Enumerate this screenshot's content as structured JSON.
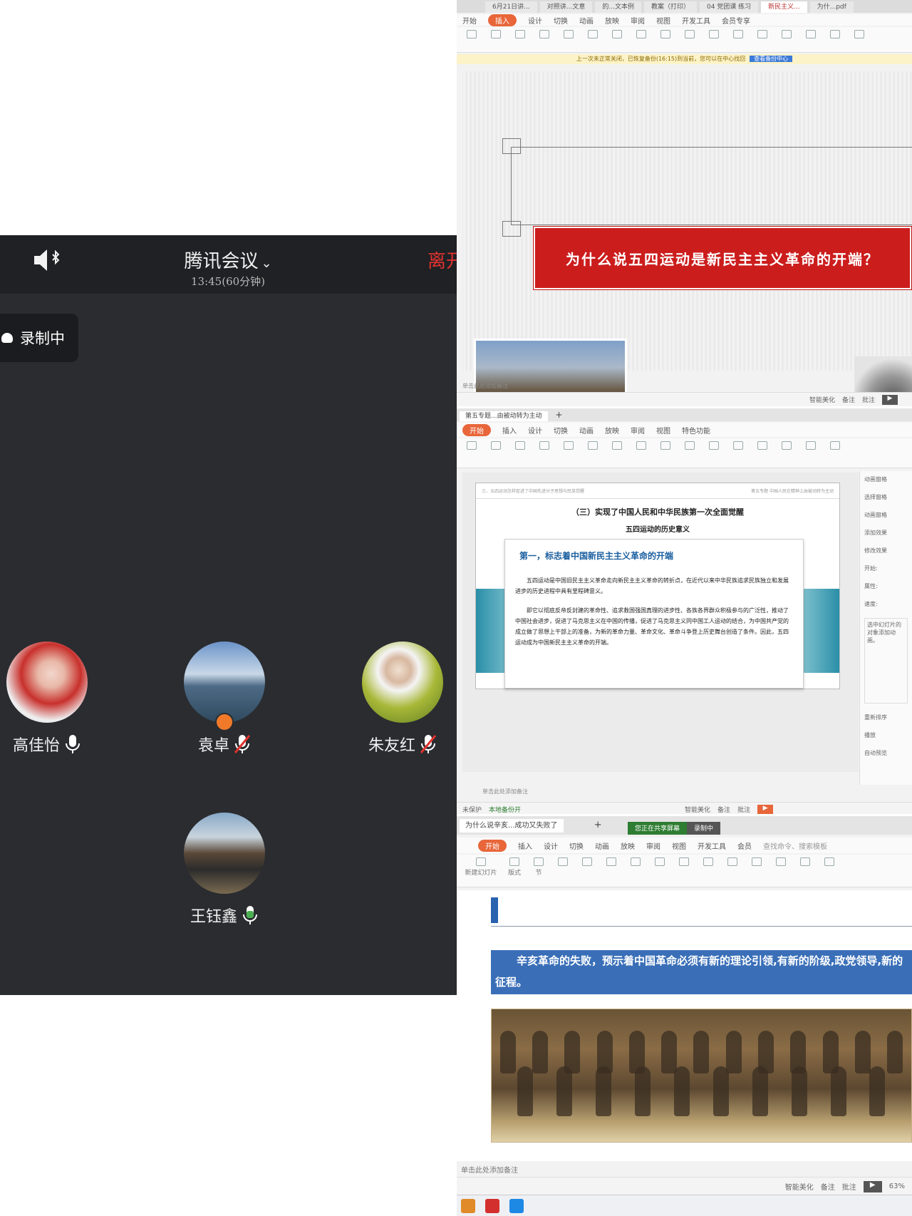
{
  "meeting": {
    "title": "腾讯会议",
    "time": "13:45(60分钟)",
    "end_label": "离开",
    "recording_label": "录制中",
    "participants": [
      {
        "name": "高佳怡",
        "mic": "on"
      },
      {
        "name": "袁卓",
        "mic": "muted",
        "host": true
      },
      {
        "name": "朱友红",
        "mic": "muted"
      },
      {
        "name": "王钰鑫",
        "mic": "active"
      }
    ],
    "colors": {
      "bg": "#2a2c30",
      "topbar": "#1f2124",
      "end": "#e0322f",
      "mic_active": "#4caf50",
      "mic_muted": "#e0322f"
    }
  },
  "screen1": {
    "tabs": [
      "6月21日讲...",
      "对照讲...文意",
      "的...文本例",
      "教案（打印）",
      "04 党团课 练习",
      "新民主义...",
      "为什...pdf"
    ],
    "menu": [
      "开始",
      "插入",
      "设计",
      "切换",
      "动画",
      "放映",
      "审阅",
      "视图",
      "开发工具",
      "会员专享"
    ],
    "warning": "上一次未正常关闭，已恢复备份(16:15)到当前，您可以在中心找回",
    "warning_btn": "查看备份中心",
    "slide_title": "为什么说五四运动是新民主主义革命的开端？",
    "notes": "单击此处添加备注",
    "status_items": [
      "智能美化",
      "备注",
      "批注"
    ]
  },
  "screen2": {
    "doc_tab": "第五专题...由被动转为主动",
    "menu": [
      "开始",
      "插入",
      "设计",
      "切换",
      "动画",
      "放映",
      "审阅",
      "视图",
      "特色功能"
    ],
    "slide_header_left": "三、五四运动怎样促进了中国先进分子思想与民族觉醒",
    "slide_header_right": "第五专题 中国人民在精神上由被动转为主动",
    "title": "（三）实现了中国人民和中华民族第一次全面觉醒",
    "subtitle": "五四运动的历史意义",
    "card_title": "第一，标志着中国新民主主义革命的开端",
    "para1": "五四运动是中国旧民主主义革命走向新民主主义革命的转折点，在近代以来中华民族追求民族独立和发展进步的历史进程中具有里程碑意义。",
    "para2": "即它以彻底反帝反封建的革命性、追求救国强国真理的进步性、各族各界群众积极参与的广泛性，推动了中国社会进步，促进了马克思主义在中国的传播，促进了马克思主义同中国工人运动的结合，为中国共产党的成立做了思想上干部上的准备，为新的革命力量、革命文化、革命斗争登上历史舞台创造了条件。因此，五四运动成为中国新民主主义革命的开端。",
    "side": [
      "动画窗格",
      "选择窗格",
      "动画窗格",
      "添加效果",
      "修改效果",
      "开始:",
      "属性:",
      "速度:",
      "选中幻灯片的对象添加动画。",
      "重新排序",
      "播放",
      "自动预览"
    ],
    "notes": "单击此处添加备注",
    "status_left": "未保护",
    "status_backup": "本地备份开",
    "status_items": [
      "智能美化",
      "备注",
      "批注"
    ]
  },
  "screen3": {
    "doc_tab": "为什么说辛亥...成功又失败了",
    "share_label": "您正在共享屏幕",
    "rec_label": "录制中",
    "menu": [
      "开始",
      "插入",
      "设计",
      "切换",
      "动画",
      "放映",
      "审阅",
      "视图",
      "开发工具",
      "会员"
    ],
    "search_placeholder": "查找命令、搜索模板",
    "tool_labels": [
      "新建幻灯片",
      "版式",
      "节"
    ],
    "blue_text": "辛亥革命的失败，预示着中国革命必须有新的理论引领,有新的阶级,政党领导,新的征程。",
    "notes": "单击此处添加备注",
    "status_items": [
      "智能美化",
      "备注",
      "批注"
    ],
    "zoom": "63%"
  }
}
